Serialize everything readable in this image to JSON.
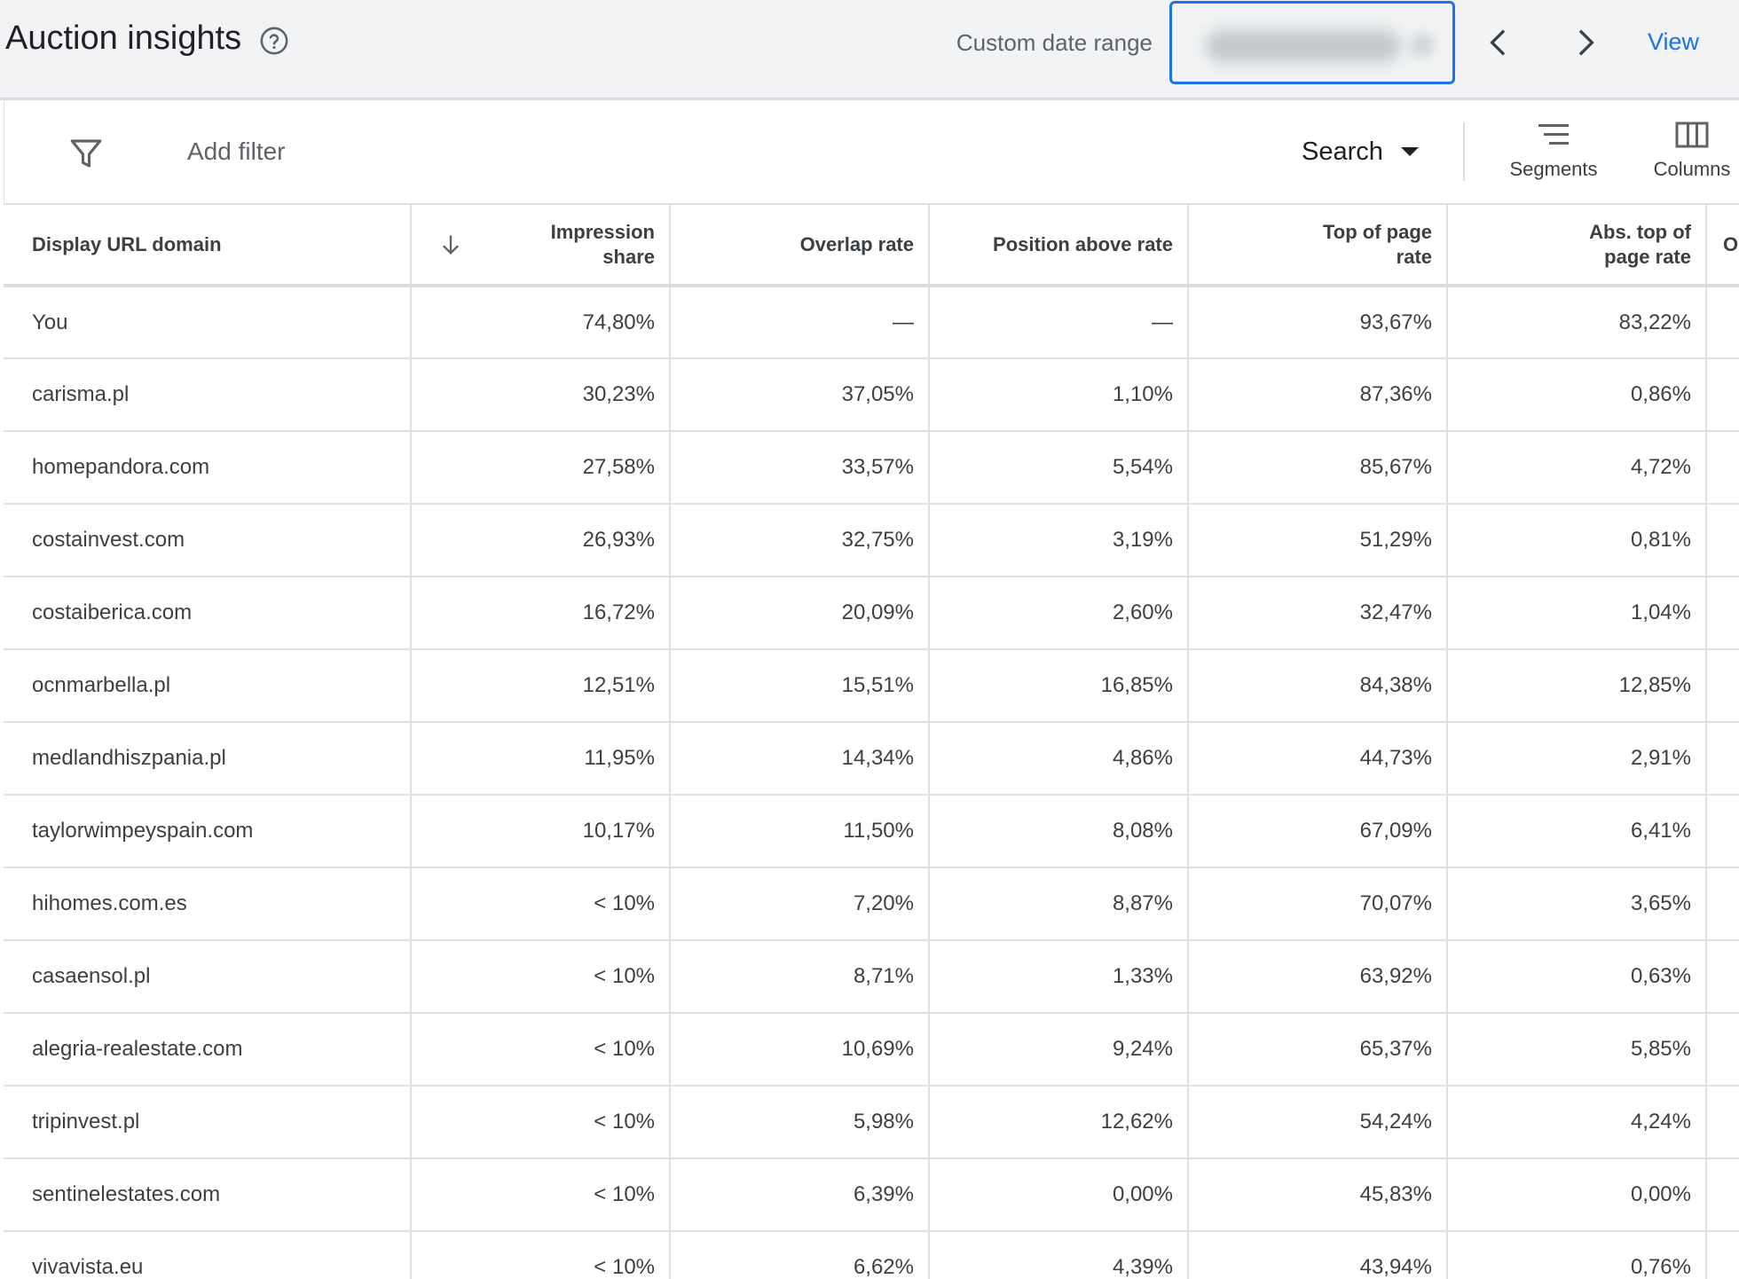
{
  "header": {
    "title": "Auction insights",
    "date_label": "Custom date range",
    "view_label": "View"
  },
  "toolbar": {
    "add_filter": "Add filter",
    "network_select": "Search",
    "segments_label": "Segments",
    "columns_label": "Columns"
  },
  "table": {
    "columns": [
      "Display URL domain",
      "Impression share",
      "Overlap rate",
      "Position above rate",
      "Top of page rate",
      "Abs. top of page rate",
      "O"
    ],
    "sort_column": "Impression share",
    "sort_direction": "descending",
    "rows": [
      {
        "domain": "You",
        "impression_share": "74,80%",
        "overlap_rate": "—",
        "position_above_rate": "—",
        "top_of_page_rate": "93,67%",
        "abs_top_of_page_rate": "83,22%"
      },
      {
        "domain": "carisma.pl",
        "impression_share": "30,23%",
        "overlap_rate": "37,05%",
        "position_above_rate": "1,10%",
        "top_of_page_rate": "87,36%",
        "abs_top_of_page_rate": "0,86%"
      },
      {
        "domain": "homepandora.com",
        "impression_share": "27,58%",
        "overlap_rate": "33,57%",
        "position_above_rate": "5,54%",
        "top_of_page_rate": "85,67%",
        "abs_top_of_page_rate": "4,72%"
      },
      {
        "domain": "costainvest.com",
        "impression_share": "26,93%",
        "overlap_rate": "32,75%",
        "position_above_rate": "3,19%",
        "top_of_page_rate": "51,29%",
        "abs_top_of_page_rate": "0,81%"
      },
      {
        "domain": "costaiberica.com",
        "impression_share": "16,72%",
        "overlap_rate": "20,09%",
        "position_above_rate": "2,60%",
        "top_of_page_rate": "32,47%",
        "abs_top_of_page_rate": "1,04%"
      },
      {
        "domain": "ocnmarbella.pl",
        "impression_share": "12,51%",
        "overlap_rate": "15,51%",
        "position_above_rate": "16,85%",
        "top_of_page_rate": "84,38%",
        "abs_top_of_page_rate": "12,85%"
      },
      {
        "domain": "medlandhiszpania.pl",
        "impression_share": "11,95%",
        "overlap_rate": "14,34%",
        "position_above_rate": "4,86%",
        "top_of_page_rate": "44,73%",
        "abs_top_of_page_rate": "2,91%"
      },
      {
        "domain": "taylorwimpeyspain.com",
        "impression_share": "10,17%",
        "overlap_rate": "11,50%",
        "position_above_rate": "8,08%",
        "top_of_page_rate": "67,09%",
        "abs_top_of_page_rate": "6,41%"
      },
      {
        "domain": "hihomes.com.es",
        "impression_share": "< 10%",
        "overlap_rate": "7,20%",
        "position_above_rate": "8,87%",
        "top_of_page_rate": "70,07%",
        "abs_top_of_page_rate": "3,65%"
      },
      {
        "domain": "casaensol.pl",
        "impression_share": "< 10%",
        "overlap_rate": "8,71%",
        "position_above_rate": "1,33%",
        "top_of_page_rate": "63,92%",
        "abs_top_of_page_rate": "0,63%"
      },
      {
        "domain": "alegria-realestate.com",
        "impression_share": "< 10%",
        "overlap_rate": "10,69%",
        "position_above_rate": "9,24%",
        "top_of_page_rate": "65,37%",
        "abs_top_of_page_rate": "5,85%"
      },
      {
        "domain": "tripinvest.pl",
        "impression_share": "< 10%",
        "overlap_rate": "5,98%",
        "position_above_rate": "12,62%",
        "top_of_page_rate": "54,24%",
        "abs_top_of_page_rate": "4,24%"
      },
      {
        "domain": "sentinelestates.com",
        "impression_share": "< 10%",
        "overlap_rate": "6,39%",
        "position_above_rate": "0,00%",
        "top_of_page_rate": "45,83%",
        "abs_top_of_page_rate": "0,00%"
      },
      {
        "domain": "vivavista.eu",
        "impression_share": "< 10%",
        "overlap_rate": "6,62%",
        "position_above_rate": "4,39%",
        "top_of_page_rate": "43,94%",
        "abs_top_of_page_rate": "0,76%"
      }
    ]
  },
  "colors": {
    "accent": "#1a73e8",
    "header_bg": "#f1f3f4",
    "grid_line": "#e0e0e0"
  },
  "icons": [
    "help-icon",
    "chevron-left-icon",
    "chevron-right-icon",
    "filter-icon",
    "dropdown-caret-icon",
    "segments-icon",
    "columns-icon",
    "sort-down-arrow-icon"
  ]
}
